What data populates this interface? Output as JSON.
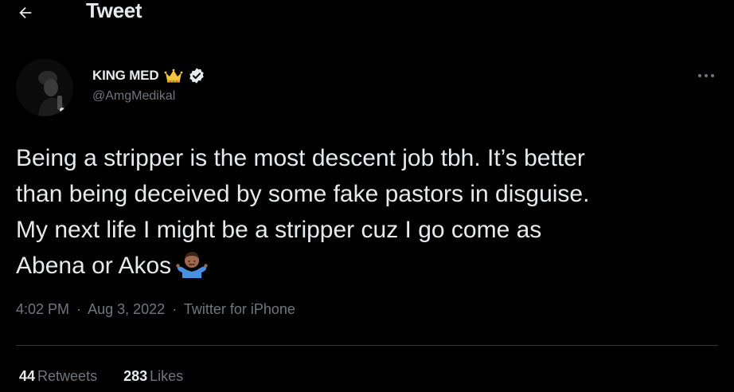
{
  "header": {
    "title": "Tweet",
    "back_icon": "arrow-left-icon"
  },
  "author": {
    "display_name": "KING MED",
    "name_emoji": "crown-icon",
    "verified_badge": "verified-badge-icon",
    "handle": "@AmgMedikal"
  },
  "tweet": {
    "lines": [
      "Being a stripper is the most descent job tbh. It’s better",
      "than being deceived by some fake pastors in disguise.",
      "My next life I might be a stripper cuz I go come as",
      "Abena or Akos"
    ],
    "trailing_emoji": "man-shrugging-emoji",
    "more_icon": "more-options-icon"
  },
  "meta": {
    "time": "4:02 PM",
    "separator": "·",
    "date": "Aug 3, 2022",
    "source": "Twitter for iPhone"
  },
  "stats": {
    "retweets_count": "44",
    "retweets_label": "Retweets",
    "likes_count": "283",
    "likes_label": "Likes"
  },
  "colors": {
    "background": "#000000",
    "primary_text": "#e7e9ea",
    "secondary_text": "#71767b",
    "divider": "#2f3336",
    "verified_badge": "#e7e9ea",
    "crown": "#f5c542"
  }
}
